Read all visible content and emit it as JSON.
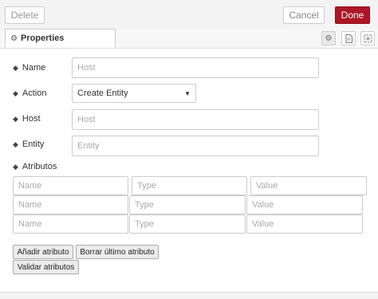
{
  "toolbar": {
    "delete_label": "Delete",
    "cancel_label": "Cancel",
    "done_label": "Done",
    "done_color": "#ad1625"
  },
  "tabs": {
    "properties_label": "Properties"
  },
  "form": {
    "name_label": "Name",
    "name_placeholder": "Host",
    "action_label": "Action",
    "action_value": "Create Entity",
    "host_label": "Host",
    "host_placeholder": "Host",
    "entity_label": "Entity",
    "entity_placeholder": "Entity",
    "attributes_label": "Atributos"
  },
  "attribute_rows": [
    {
      "name_placeholder": "Name",
      "type_placeholder": "Type",
      "value_placeholder": "Value"
    },
    {
      "name_placeholder": "Name",
      "type_placeholder": "Type",
      "value_placeholder": "Value"
    },
    {
      "name_placeholder": "Name",
      "type_placeholder": "Type",
      "value_placeholder": "Value"
    }
  ],
  "buttons": {
    "add_attribute": "Añadir atributo",
    "remove_last_attribute": "Borrar último atributo",
    "validate_attributes": "Validar atributos"
  }
}
